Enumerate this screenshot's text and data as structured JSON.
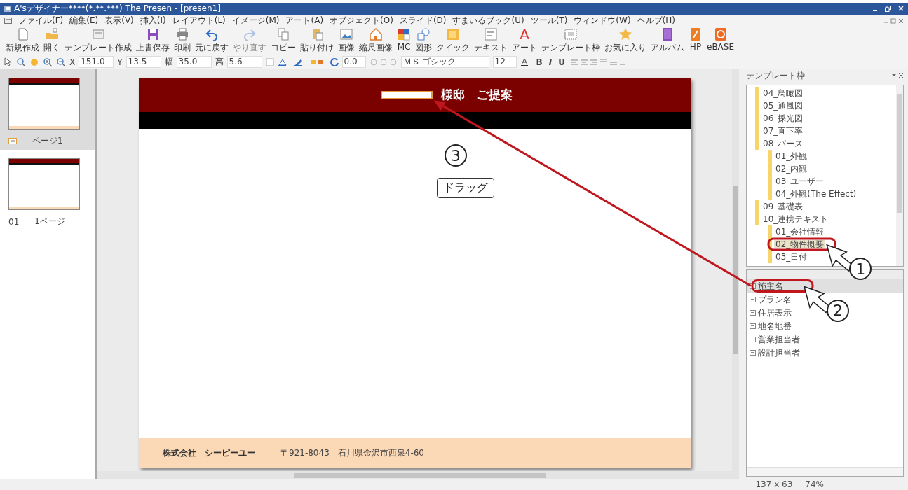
{
  "window": {
    "title": "A'sデザイナー****(*.**.***) The Presen - [presen1]"
  },
  "menu": [
    "ファイル(F)",
    "編集(E)",
    "表示(V)",
    "挿入(I)",
    "レイアウト(L)",
    "イメージ(M)",
    "アート(A)",
    "オブジェクト(O)",
    "スライド(D)",
    "すまいるブック(U)",
    "ツール(T)",
    "ウィンドウ(W)",
    "ヘルプ(H)"
  ],
  "toolbar": [
    {
      "label": "新規作成",
      "disabled": false
    },
    {
      "label": "開く",
      "disabled": false
    },
    {
      "label": "テンプレート作成",
      "disabled": false
    },
    {
      "label": "上書保存",
      "disabled": false
    },
    {
      "label": "印刷",
      "disabled": false
    },
    {
      "label": "元に戻す",
      "disabled": false
    },
    {
      "label": "やり直す",
      "disabled": true
    },
    {
      "label": "コピー",
      "disabled": false
    },
    {
      "label": "貼り付け",
      "disabled": false
    },
    {
      "label": "画像",
      "disabled": false
    },
    {
      "label": "縮尺画像",
      "disabled": false
    },
    {
      "label": "MC",
      "disabled": false
    },
    {
      "label": "図形",
      "disabled": false
    },
    {
      "label": "クイック",
      "disabled": false
    },
    {
      "label": "テキスト",
      "disabled": false
    },
    {
      "label": "アート",
      "disabled": false,
      "glyph": "A"
    },
    {
      "label": "テンプレート枠",
      "disabled": false
    },
    {
      "label": "お気に入り",
      "disabled": false
    },
    {
      "label": "アルバム",
      "disabled": false
    },
    {
      "label": "HP",
      "disabled": false
    },
    {
      "label": "eBASE",
      "disabled": false
    }
  ],
  "format_bar": {
    "fields": [
      {
        "label": "X",
        "value": "151.0"
      },
      {
        "label": "Y",
        "value": "13.5"
      },
      {
        "label": "幅",
        "value": "35.0"
      },
      {
        "label": "高",
        "value": "5.6"
      }
    ],
    "rotation": "0.0",
    "font": "ＭＳ ゴシック",
    "size": "12",
    "styles": [
      "B",
      "I",
      "U"
    ]
  },
  "pages": [
    {
      "label": "ページ1",
      "selected": true
    },
    {
      "number": "01",
      "label": "1ページ",
      "selected": false
    }
  ],
  "slide": {
    "title": "様邸　ご提案",
    "company": "株式会社　シーピーユー",
    "address": "〒921-8043　石川県金沢市西泉4-60"
  },
  "template_panel": {
    "title": "テンプレート枠",
    "tree": [
      {
        "label": "04_鳥瞰図",
        "selected": false
      },
      {
        "label": "05_通風図",
        "selected": false
      },
      {
        "label": "06_採光図",
        "selected": false
      },
      {
        "label": "07_直下率",
        "selected": false
      },
      {
        "label": "08_パース",
        "selected": false,
        "children": [
          {
            "label": "01_外観",
            "selected": false
          },
          {
            "label": "02_内観",
            "selected": false
          },
          {
            "label": "03_ユーザー",
            "selected": false
          },
          {
            "label": "04_外観(The Effect)",
            "selected": false
          }
        ]
      },
      {
        "label": "09_基礎表",
        "selected": false
      },
      {
        "label": "10_連携テキスト",
        "selected": false,
        "children": [
          {
            "label": "01_会社情報",
            "selected": false
          },
          {
            "label": "02_物件概要",
            "selected": true
          },
          {
            "label": "03_日付",
            "selected": false
          }
        ]
      }
    ],
    "items": [
      {
        "label": "施主名",
        "selected": true
      },
      {
        "label": "プラン名",
        "selected": false
      },
      {
        "label": "住居表示",
        "selected": false
      },
      {
        "label": "地名地番",
        "selected": false
      },
      {
        "label": "営業担当者",
        "selected": false
      },
      {
        "label": "設計担当者",
        "selected": false
      }
    ]
  },
  "status_bar": [
    "137 x 63",
    "74%"
  ],
  "annotations": {
    "steps": [
      "1",
      "2",
      "3"
    ],
    "drag_label": "ドラッグ"
  }
}
